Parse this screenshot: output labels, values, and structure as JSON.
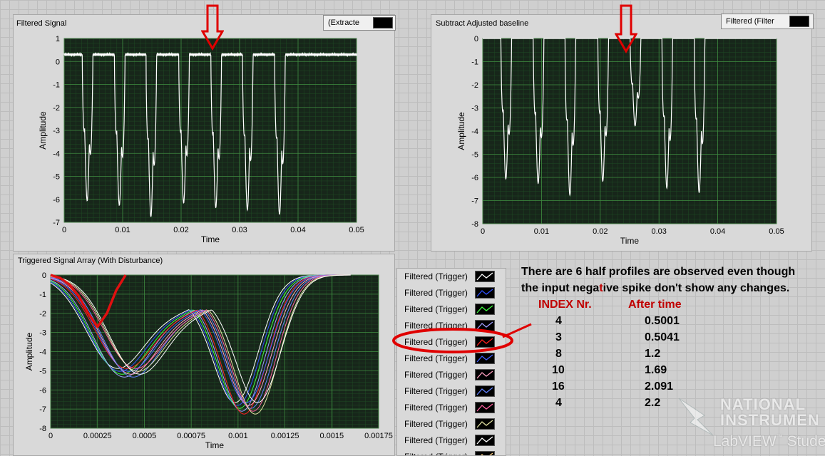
{
  "charts": {
    "filtered": {
      "title": "Filtered Signal",
      "legend": "(Extracte",
      "ylabel": "Amplitude",
      "xlabel": "Time",
      "yticks": [
        "1",
        "0",
        "-1",
        "-2",
        "-3",
        "-4",
        "-5",
        "-6",
        "-7"
      ],
      "xticks": [
        "0",
        "0.01",
        "0.02",
        "0.03",
        "0.04",
        "0.05"
      ]
    },
    "subtract": {
      "title": "Subtract Adjusted baseline",
      "legend": "Filtered (Filter",
      "ylabel": "Amplitude",
      "xlabel": "Time",
      "yticks": [
        "0",
        "-1",
        "-2",
        "-3",
        "-4",
        "-5",
        "-6",
        "-7",
        "-8"
      ],
      "xticks": [
        "0",
        "0.01",
        "0.02",
        "0.03",
        "0.04",
        "0.05"
      ]
    },
    "triggered": {
      "title": "Triggered Signal Array (With Disturbance)",
      "ylabel": "Amplitude",
      "xlabel": "Time",
      "yticks": [
        "0",
        "-1",
        "-2",
        "-3",
        "-4",
        "-5",
        "-6",
        "-7",
        "-8"
      ],
      "xticks": [
        "0",
        "0.00025",
        "0.0005",
        "0.00075",
        "0.001",
        "0.00125",
        "0.0015",
        "0.00175"
      ]
    }
  },
  "chart_data": [
    {
      "type": "line",
      "title": "Filtered Signal",
      "xlabel": "Time",
      "ylabel": "Amplitude",
      "xlim": [
        0,
        0.05
      ],
      "ylim": [
        -7,
        1
      ],
      "series": [
        {
          "name": "(Extracte",
          "baseline": 0.3,
          "pulse_period": 0.0055,
          "pulse_min_values": [
            -6.1,
            -6.3,
            -6.8,
            -6.2,
            -6.4,
            -6.5,
            -6.7
          ]
        }
      ]
    },
    {
      "type": "line",
      "title": "Subtract Adjusted baseline",
      "xlabel": "Time",
      "ylabel": "Amplitude",
      "xlim": [
        0,
        0.05
      ],
      "ylim": [
        -8,
        0
      ],
      "series": [
        {
          "name": "Filtered (Filter",
          "baseline": 0,
          "pulse_period": 0.0055,
          "pulse_min_values": [
            -6.1,
            -6.3,
            -6.8,
            -6.2,
            -3.8,
            -6.5,
            -6.7
          ]
        }
      ]
    },
    {
      "type": "line",
      "title": "Triggered Signal Array (With Disturbance)",
      "xlabel": "Time",
      "ylabel": "Amplitude",
      "xlim": [
        0,
        0.00175
      ],
      "ylim": [
        -8,
        0
      ],
      "series_count": 11,
      "disturbed_series": {
        "x": [
          0,
          5e-05,
          0.0001,
          0.00015,
          0.0002,
          0.00025,
          0.0003,
          0.00035,
          0.0004
        ],
        "y": [
          0,
          -0.15,
          -0.5,
          -1.1,
          -2.0,
          -2.7,
          -2.0,
          -0.8,
          0
        ]
      }
    }
  ],
  "legend_items": [
    {
      "label": "Filtered (Trigger)",
      "color": "#ffffff"
    },
    {
      "label": "Filtered (Trigger)",
      "color": "#3050ff"
    },
    {
      "label": "Filtered (Trigger)",
      "color": "#40ff40"
    },
    {
      "label": "Filtered (Trigger)",
      "color": "#a0a0ff"
    },
    {
      "label": "Filtered (Trigger)",
      "color": "#ff2020"
    },
    {
      "label": "Filtered (Trigger)",
      "color": "#4060ff"
    },
    {
      "label": "Filtered (Trigger)",
      "color": "#ffa0c0"
    },
    {
      "label": "Filtered (Trigger)",
      "color": "#6080ff"
    },
    {
      "label": "Filtered (Trigger)",
      "color": "#ff60a0"
    },
    {
      "label": "Filtered (Trigger)",
      "color": "#e0e0a0"
    },
    {
      "label": "Filtered (Trigger)",
      "color": "#ffffff"
    },
    {
      "label": "Filtered (Trigger)",
      "color": "#ffd080"
    }
  ],
  "annotation": {
    "line1": "There are 6 half profiles are observed even though",
    "line2_a": "the input nega",
    "line2_b": "t",
    "line2_c": "ive spike don't show any changes.",
    "col1_header": "INDEX Nr.",
    "col2_header": "After time",
    "rows": [
      {
        "index": "4",
        "time": "0.5001"
      },
      {
        "index": "3",
        "time": "0.5041"
      },
      {
        "index": "8",
        "time": "1.2"
      },
      {
        "index": "10",
        "time": "1.69"
      },
      {
        "index": "16",
        "time": "2.091"
      },
      {
        "index": "4",
        "time": "2.2"
      }
    ]
  },
  "watermark": {
    "line1": "NATIONAL",
    "line2": "INSTRUMEN",
    "line3": "LabVIEW",
    "line3b": "Studen"
  }
}
